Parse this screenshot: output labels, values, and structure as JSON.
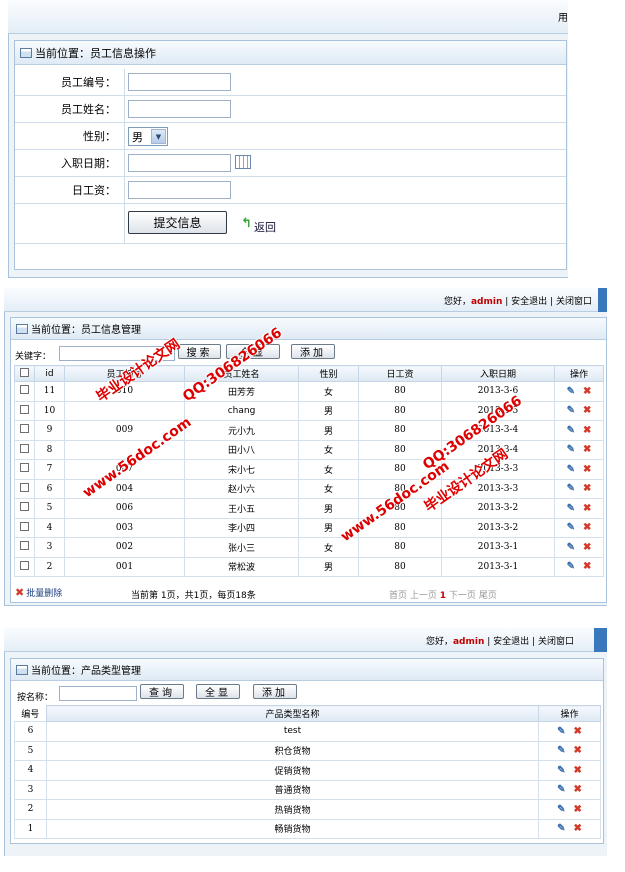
{
  "section1": {
    "top_label": "用",
    "title": "当前位置：员工信息操作",
    "fields": [
      {
        "label": "员工编号：",
        "value": ""
      },
      {
        "label": "员工姓名：",
        "value": ""
      },
      {
        "label": "性别：",
        "value": "男"
      },
      {
        "label": "入职日期：",
        "value": ""
      },
      {
        "label": "日工资：",
        "value": ""
      }
    ],
    "submit_label": "提交信息",
    "back_label": "返回"
  },
  "header": {
    "greeting": "您好，",
    "user": "admin",
    "logout": "安全退出",
    "close": "关闭窗口",
    "sep": "|"
  },
  "section2": {
    "title": "当前位置：员工信息管理",
    "keyword_label": "关键字：",
    "keyword_value": "",
    "search_label": "搜索",
    "showall_label": "全显",
    "add_label": "添加",
    "columns": [
      "id",
      "员工编号",
      "员工姓名",
      "性别",
      "日工资",
      "入职日期",
      "操作"
    ],
    "rows": [
      {
        "id": "11",
        "no": "010",
        "name": "田芳芳",
        "sex": "女",
        "wage": "80",
        "date": "2013-3-6"
      },
      {
        "id": "10",
        "no": "",
        "name": "chang",
        "sex": "男",
        "wage": "80",
        "date": "2013-3-5"
      },
      {
        "id": "9",
        "no": "009",
        "name": "元小九",
        "sex": "男",
        "wage": "80",
        "date": "2013-3-4"
      },
      {
        "id": "8",
        "no": "",
        "name": "田小八",
        "sex": "女",
        "wage": "80",
        "date": "2013-3-4"
      },
      {
        "id": "7",
        "no": "007",
        "name": "宋小七",
        "sex": "女",
        "wage": "80",
        "date": "2013-3-3"
      },
      {
        "id": "6",
        "no": "004",
        "name": "赵小六",
        "sex": "女",
        "wage": "80",
        "date": "2013-3-3"
      },
      {
        "id": "5",
        "no": "006",
        "name": "王小五",
        "sex": "男",
        "wage": "80",
        "date": "2013-3-2"
      },
      {
        "id": "4",
        "no": "003",
        "name": "李小四",
        "sex": "男",
        "wage": "80",
        "date": "2013-3-2"
      },
      {
        "id": "3",
        "no": "002",
        "name": "张小三",
        "sex": "女",
        "wage": "80",
        "date": "2013-3-1"
      },
      {
        "id": "2",
        "no": "001",
        "name": "常松波",
        "sex": "男",
        "wage": "80",
        "date": "2013-3-1"
      }
    ],
    "batch_delete": "批量删除",
    "page_info": "当前第 1页，共1页，每页18条",
    "pager": {
      "first": "首页",
      "prev": "上一页",
      "current": "1",
      "next": "下一页",
      "last": "尾页"
    }
  },
  "section3": {
    "title": "当前位置：产品类型管理",
    "name_label": "按名称：",
    "name_value": "",
    "search_label": "查询",
    "showall_label": "全显",
    "add_label": "添加",
    "columns": [
      "编号",
      "产品类型名称",
      "操作"
    ],
    "rows": [
      {
        "no": "6",
        "name": "test"
      },
      {
        "no": "5",
        "name": "积仓货物"
      },
      {
        "no": "4",
        "name": "促销货物"
      },
      {
        "no": "3",
        "name": "普通货物"
      },
      {
        "no": "2",
        "name": "热销货物"
      },
      {
        "no": "1",
        "name": "畅销货物"
      }
    ]
  },
  "watermarks": [
    "毕业设计论文网",
    "QQ:306826066",
    "www.56doc.com"
  ]
}
